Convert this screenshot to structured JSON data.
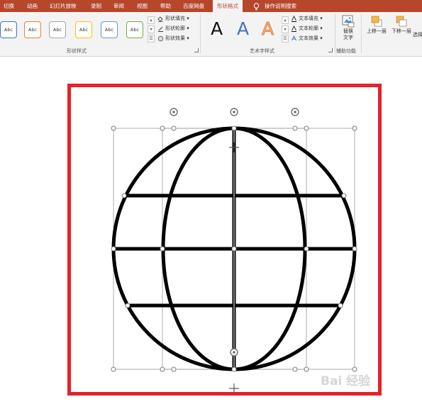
{
  "tabs": [
    "切换",
    "动画",
    "幻灯片放映",
    "录制",
    "审阅",
    "视图",
    "帮助",
    "百度网盘",
    "形状格式",
    "操作说明搜索"
  ],
  "active_tab": "形状格式",
  "ribbon": {
    "style_samples": [
      "Abc",
      "Abc",
      "Abc",
      "Abc",
      "Abc",
      "Abc"
    ],
    "shape_fill": "形状填充",
    "shape_outline": "形状轮廓",
    "shape_effect": "形状效果",
    "group_shape_styles": "形状样式",
    "wordart_letters": [
      "A",
      "A",
      "A"
    ],
    "text_fill": "文本填充",
    "text_outline": "文本轮廓",
    "text_effect": "文本效果",
    "group_wordart": "艺术字样式",
    "replace_text_line1": "替换",
    "replace_text_line2": "文字",
    "group_accessibility": "辅助功能",
    "bring_forward": "上移一层",
    "send_backward": "下移一层",
    "selection": "选择"
  },
  "colors": {
    "tabbar": "#b7472a",
    "frame": "#e8202a",
    "sample_borders": [
      "#4472c4",
      "#ed7d31",
      "#a5a5a5",
      "#ffc000",
      "#5b9bd5",
      "#70ad47"
    ]
  },
  "watermark": "Bai 经验"
}
